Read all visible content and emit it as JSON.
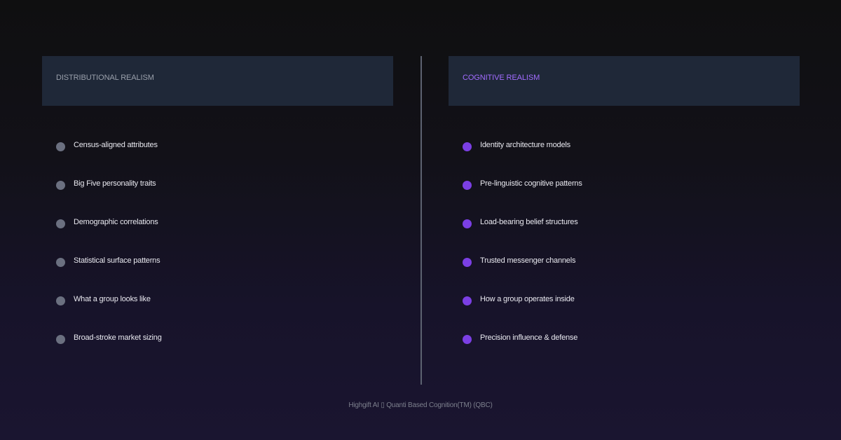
{
  "colors": {
    "left_title": "#9aa0ab",
    "right_title": "#a26cff",
    "left_bullet": "#6b7080",
    "right_bullet": "#7b3fe4"
  },
  "left": {
    "title": "DISTRIBUTIONAL REALISM",
    "items": [
      "Census-aligned attributes",
      "Big Five personality traits",
      "Demographic correlations",
      "Statistical surface patterns",
      "What a group looks like",
      "Broad-stroke market sizing"
    ]
  },
  "right": {
    "title": "COGNITIVE REALISM",
    "items": [
      "Identity architecture models",
      "Pre-linguistic cognitive patterns",
      "Load-bearing belief structures",
      "Trusted messenger channels",
      "How a group operates inside",
      "Precision influence & defense"
    ]
  },
  "footer": {
    "text": "Highgift AI ▯ Quanti Based Cognition(TM) (QBC)"
  }
}
